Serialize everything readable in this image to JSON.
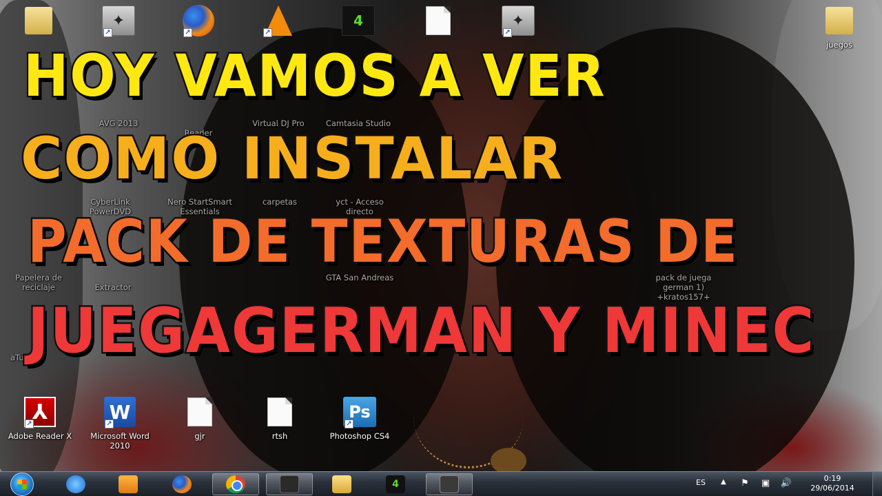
{
  "headline": {
    "line1": "HOY VAMOS A VER",
    "line2": "COMO INSTALAR",
    "line3": "PACK DE TEXTURAS DE",
    "line4": "JUEGAGERMAN Y MINEC"
  },
  "desktop_icons": [
    {
      "label": "",
      "icon": "user-folder-icon"
    },
    {
      "label": "",
      "icon": "counter-strike-icon"
    },
    {
      "label": "",
      "icon": "firefox-icon"
    },
    {
      "label": "",
      "icon": "vlc-icon"
    },
    {
      "label": "",
      "icon": "nvidia-game-icon"
    },
    {
      "label": "",
      "icon": "text-document-icon"
    },
    {
      "label": "",
      "icon": "counter-strike-admin-icon"
    },
    {
      "label": "juegos",
      "icon": "folder-icon"
    },
    {
      "label": "AVG 2013",
      "icon": "avg-icon"
    },
    {
      "label": "Reader",
      "icon": "reader-icon"
    },
    {
      "label": "Virtual DJ Pro",
      "icon": "virtual-dj-icon"
    },
    {
      "label": "Camtasia Studio",
      "icon": "camtasia-icon"
    },
    {
      "label": "CyberLink PowerDVD",
      "icon": "powerdvd-icon"
    },
    {
      "label": "Nero StartSmart Essentials",
      "icon": "nero-icon"
    },
    {
      "label": "carpetas",
      "icon": "folder-icon"
    },
    {
      "label": "yct - Acceso directo",
      "icon": "shortcut-icon"
    },
    {
      "label": "Papelera de reciclaje",
      "icon": "recycle-bin-icon"
    },
    {
      "label": "Extractor",
      "icon": "extractor-icon"
    },
    {
      "label": "GTA San Andreas",
      "icon": "gta-icon"
    },
    {
      "label": "pack de juega german 1) +kratos157+",
      "icon": "winrar-icon"
    },
    {
      "label": "aTube",
      "icon": "atube-icon"
    },
    {
      "label": "Adobe Reader X",
      "icon": "adobe-reader-icon"
    },
    {
      "label": "Microsoft Word 2010",
      "icon": "word-icon"
    },
    {
      "label": "gjr",
      "icon": "text-document-icon"
    },
    {
      "label": "rtsh",
      "icon": "text-document-icon"
    },
    {
      "label": "Photoshop CS4",
      "icon": "photoshop-icon"
    }
  ],
  "taskbar": {
    "language": "ES",
    "time": "0:19",
    "date": "29/06/2014",
    "nv_text": "4"
  },
  "icon_text": {
    "pdf": "⅄",
    "word": "W",
    "ps": "Ps",
    "nv": "4",
    "cs": "✦"
  }
}
